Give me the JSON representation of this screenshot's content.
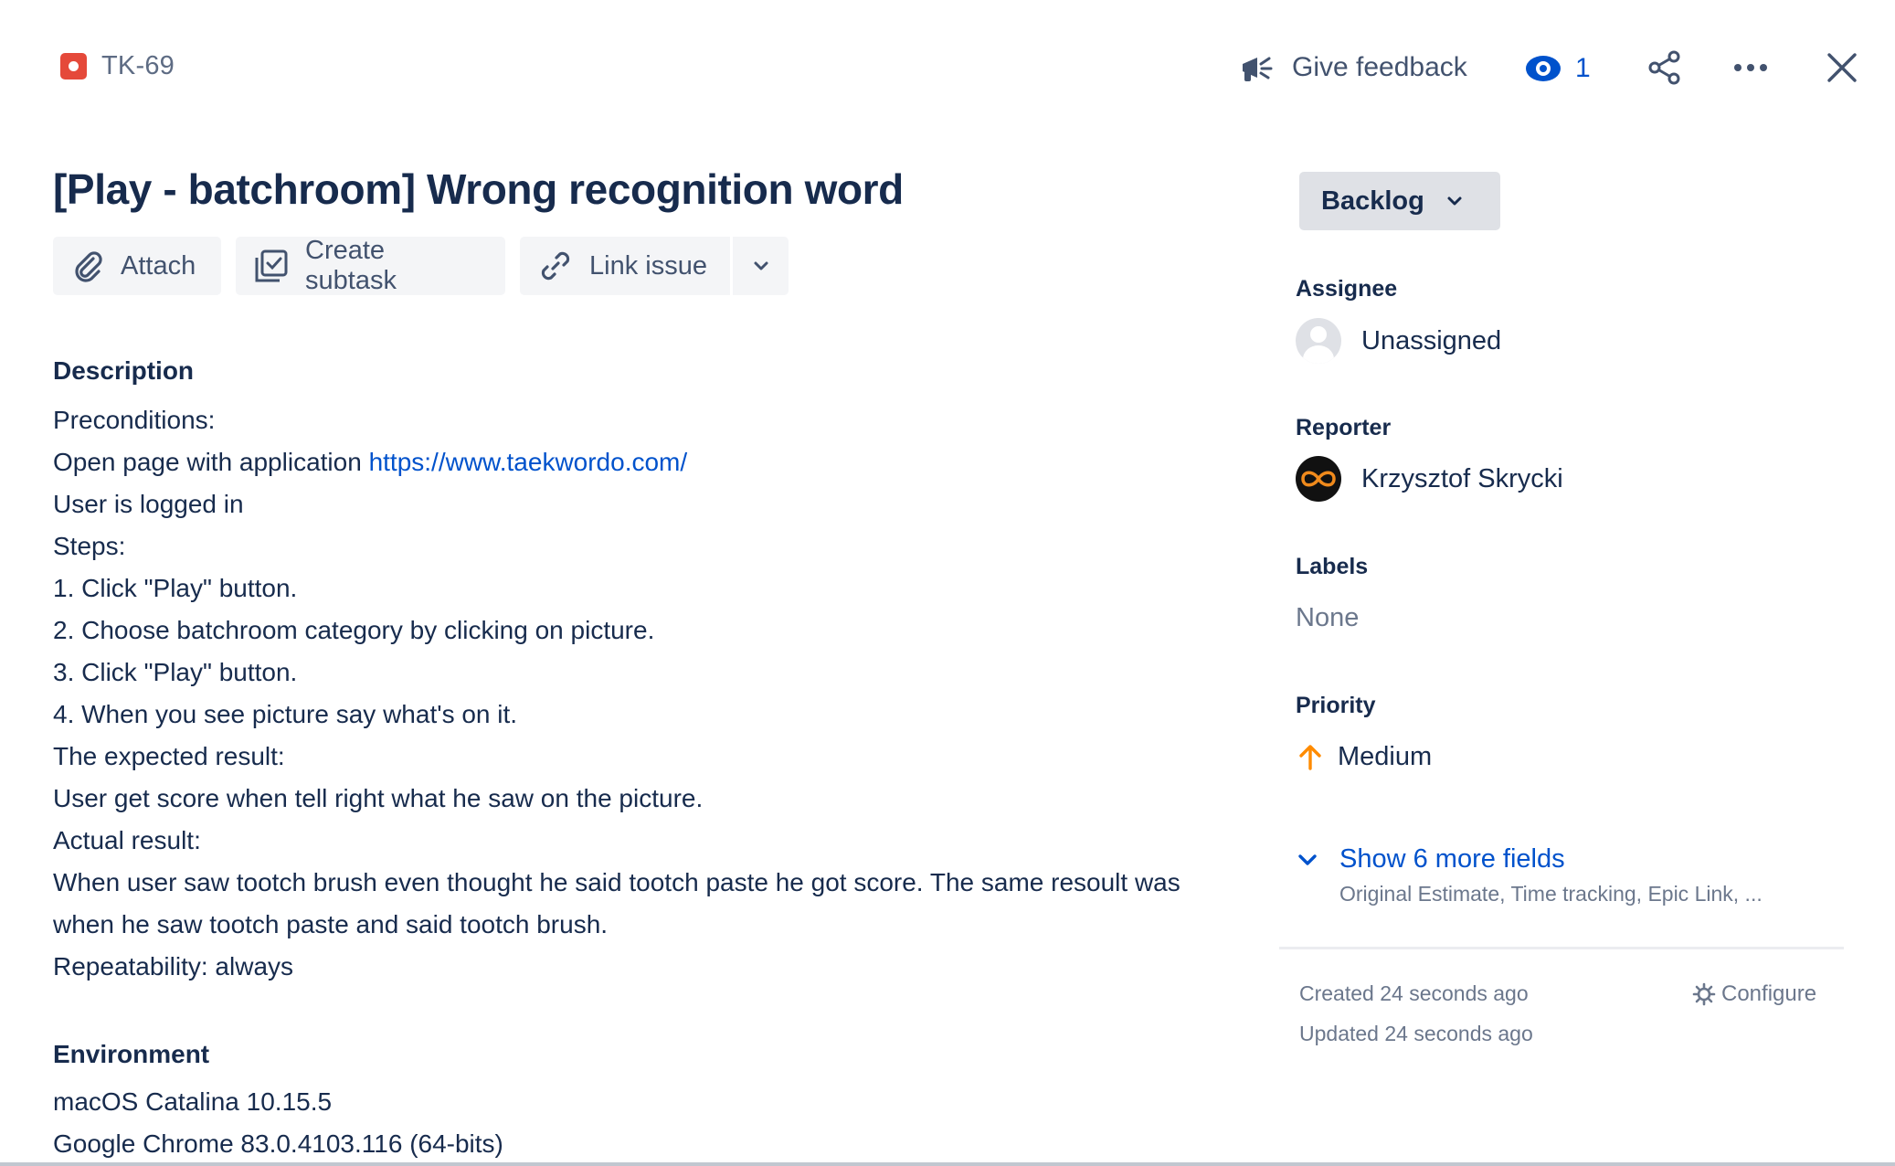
{
  "header": {
    "issue_key": "TK-69",
    "feedback_label": "Give feedback",
    "watch_count": "1"
  },
  "issue": {
    "title": "[Play - batchroom] Wrong recognition word"
  },
  "toolbar": {
    "attach_label": "Attach",
    "create_subtask_label": "Create subtask",
    "link_issue_label": "Link issue"
  },
  "description": {
    "heading": "Description",
    "lines": [
      "Preconditions:",
      "Open page with application ",
      "User is logged in",
      "Steps:",
      "1. Click \"Play\" button.",
      "2. Choose batchroom category by clicking on picture.",
      "3. Click \"Play\" button.",
      "4. When you see picture say what's on it.",
      "The expected result:",
      "User get score when tell right what he saw on the picture.",
      "Actual result:",
      "When user saw tootch brush even thought he said tootch paste he got score. The same resoult was when he saw tootch paste and said tootch brush.",
      "Repeatability: always"
    ],
    "link": "https://www.taekwordo.com/"
  },
  "environment": {
    "heading": "Environment",
    "lines": [
      "macOS Catalina 10.15.5",
      "Google Chrome 83.0.4103.116 (64-bits)"
    ]
  },
  "sidebar": {
    "status": "Backlog",
    "assignee_label": "Assignee",
    "assignee_value": "Unassigned",
    "reporter_label": "Reporter",
    "reporter_value": "Krzysztof Skrycki",
    "labels_label": "Labels",
    "labels_value": "None",
    "priority_label": "Priority",
    "priority_value": "Medium",
    "more_fields_label": "Show 6 more fields",
    "more_fields_sub": "Original Estimate, Time tracking, Epic Link, ...",
    "created": "Created 24 seconds ago",
    "updated": "Updated 24 seconds ago",
    "configure_label": "Configure"
  },
  "colors": {
    "link": "#0052cc",
    "bug": "#e5493a",
    "priority_medium": "#ff8b00"
  }
}
